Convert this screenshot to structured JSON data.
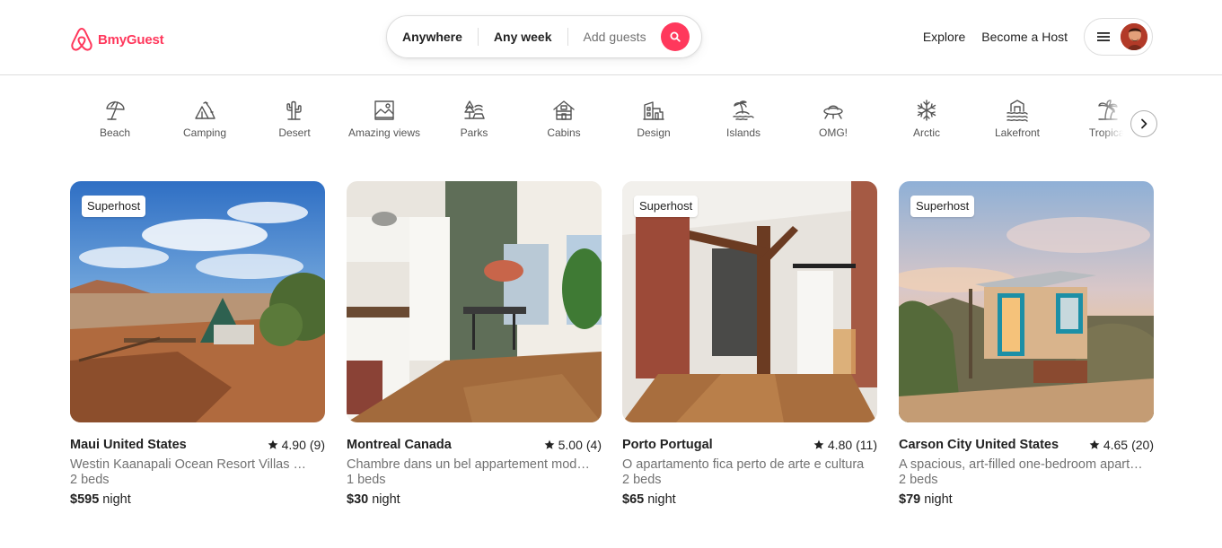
{
  "brand": {
    "name": "BmyGuest",
    "color": "#ff385c"
  },
  "search": {
    "location": "Anywhere",
    "dates": "Any week",
    "guests_placeholder": "Add guests",
    "icon": "search-icon"
  },
  "nav": {
    "explore": "Explore",
    "host": "Become a Host",
    "menu_icon": "hamburger-icon"
  },
  "categories": [
    {
      "label": "Beach",
      "icon": "beach-umbrella-icon"
    },
    {
      "label": "Camping",
      "icon": "tent-icon"
    },
    {
      "label": "Desert",
      "icon": "cactus-icon"
    },
    {
      "label": "Amazing views",
      "icon": "landscape-frame-icon"
    },
    {
      "label": "Parks",
      "icon": "trees-icon"
    },
    {
      "label": "Cabins",
      "icon": "cabin-icon"
    },
    {
      "label": "Design",
      "icon": "building-icon"
    },
    {
      "label": "Islands",
      "icon": "island-icon"
    },
    {
      "label": "OMG!",
      "icon": "ufo-icon"
    },
    {
      "label": "Arctic",
      "icon": "snowflake-icon"
    },
    {
      "label": "Lakefront",
      "icon": "lake-house-icon"
    },
    {
      "label": "Tropical",
      "icon": "palm-tree-icon"
    }
  ],
  "listings": [
    {
      "badge": "Superhost",
      "location": "Maui United States",
      "rating": "4.90",
      "reviews": "(9)",
      "description": "Westin Kaanapali Ocean Resort Villas North",
      "beds": "2 beds",
      "price": "$595",
      "price_unit": "night"
    },
    {
      "badge": "",
      "location": "Montreal Canada",
      "rating": "5.00",
      "reviews": "(4)",
      "description": "Chambre dans un bel appartement moderne",
      "beds": "1 beds",
      "price": "$30",
      "price_unit": "night"
    },
    {
      "badge": "Superhost",
      "location": "Porto Portugal",
      "rating": "4.80",
      "reviews": "(11)",
      "description": "O apartamento fica perto de arte e cultura",
      "beds": "2 beds",
      "price": "$65",
      "price_unit": "night"
    },
    {
      "badge": "Superhost",
      "location": "Carson City United States",
      "rating": "4.65",
      "reviews": "(20)",
      "description": "A spacious, art-filled one-bedroom apartment",
      "beds": "2 beds",
      "price": "$79",
      "price_unit": "night"
    }
  ]
}
